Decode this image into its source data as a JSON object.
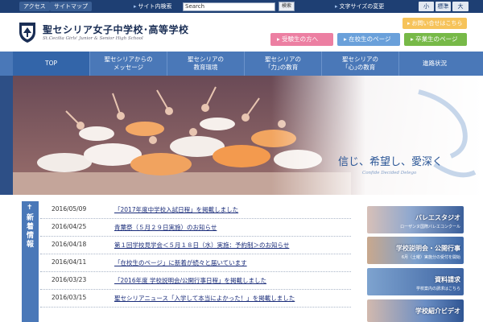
{
  "topbar": {
    "access_label": "アクセス",
    "sitemap_label": "サイトマップ",
    "site_search_label": "サイト内検索",
    "search_input_value": "Search",
    "search_button_label": "検索",
    "font_size_label": "文字サイズの変更",
    "font_small": "小",
    "font_standard": "標準",
    "font_large": "大"
  },
  "header": {
    "school_name": "聖セシリア女子中学校･高等学校",
    "school_name_en": "St.Cecilia Girls' Junior & Senior High School",
    "contact_label": "お問い合せはこちら",
    "audience": [
      {
        "label": "受験生の方へ"
      },
      {
        "label": "在校生のページ"
      },
      {
        "label": "卒業生のページ"
      }
    ]
  },
  "nav": [
    {
      "line1": "TOP",
      "line2": ""
    },
    {
      "line1": "聖セシリアからの",
      "line2": "メッセージ"
    },
    {
      "line1": "聖セシリアの",
      "line2": "教育環境"
    },
    {
      "line1": "聖セシリアの",
      "line2": "｢力｣の教育"
    },
    {
      "line1": "聖セシリアの",
      "line2": "｢心｣の教育"
    },
    {
      "line1": "進路状況",
      "line2": ""
    }
  ],
  "hero": {
    "tagline": "信じ、希望し、愛深く",
    "motto": "Confide Decided Delego"
  },
  "news": {
    "label": "新着情報",
    "items": [
      {
        "date": "2016/05/09",
        "title": "「2017年度中学校入試日程」を掲載しました"
      },
      {
        "date": "2016/04/25",
        "title": "青葉祭（５月２９日実施）のお知らせ"
      },
      {
        "date": "2016/04/18",
        "title": "第１回学校見学会＜５月１８日（水）実施：予約制＞のお知らせ"
      },
      {
        "date": "2016/04/11",
        "title": "「在校生のページ」に新着が続々と届いています"
      },
      {
        "date": "2016/03/23",
        "title": "「2016年度 学校説明会/公開行事日程」を掲載しました"
      },
      {
        "date": "2016/03/15",
        "title": "聖セシリアニュース「入学して本当によかった！」を掲載しました"
      }
    ]
  },
  "banners": [
    {
      "label": "バレエスタジオ",
      "sub": "ローザンヌ国際バレエコンクール"
    },
    {
      "label": "学校説明会・公開行事",
      "sub": "6月（土曜）実施分の受付を開始"
    },
    {
      "label": "資料請求",
      "sub": "学校案内の請求はこちら"
    },
    {
      "label": "学校紹介ビデオ",
      "sub": ""
    }
  ],
  "colors": {
    "navy": "#1e3f73",
    "nav_blue": "#4a78b8",
    "pink": "#ec7fa2",
    "light_blue": "#6aa0da",
    "green": "#77b948",
    "orange": "#f6c35a"
  }
}
